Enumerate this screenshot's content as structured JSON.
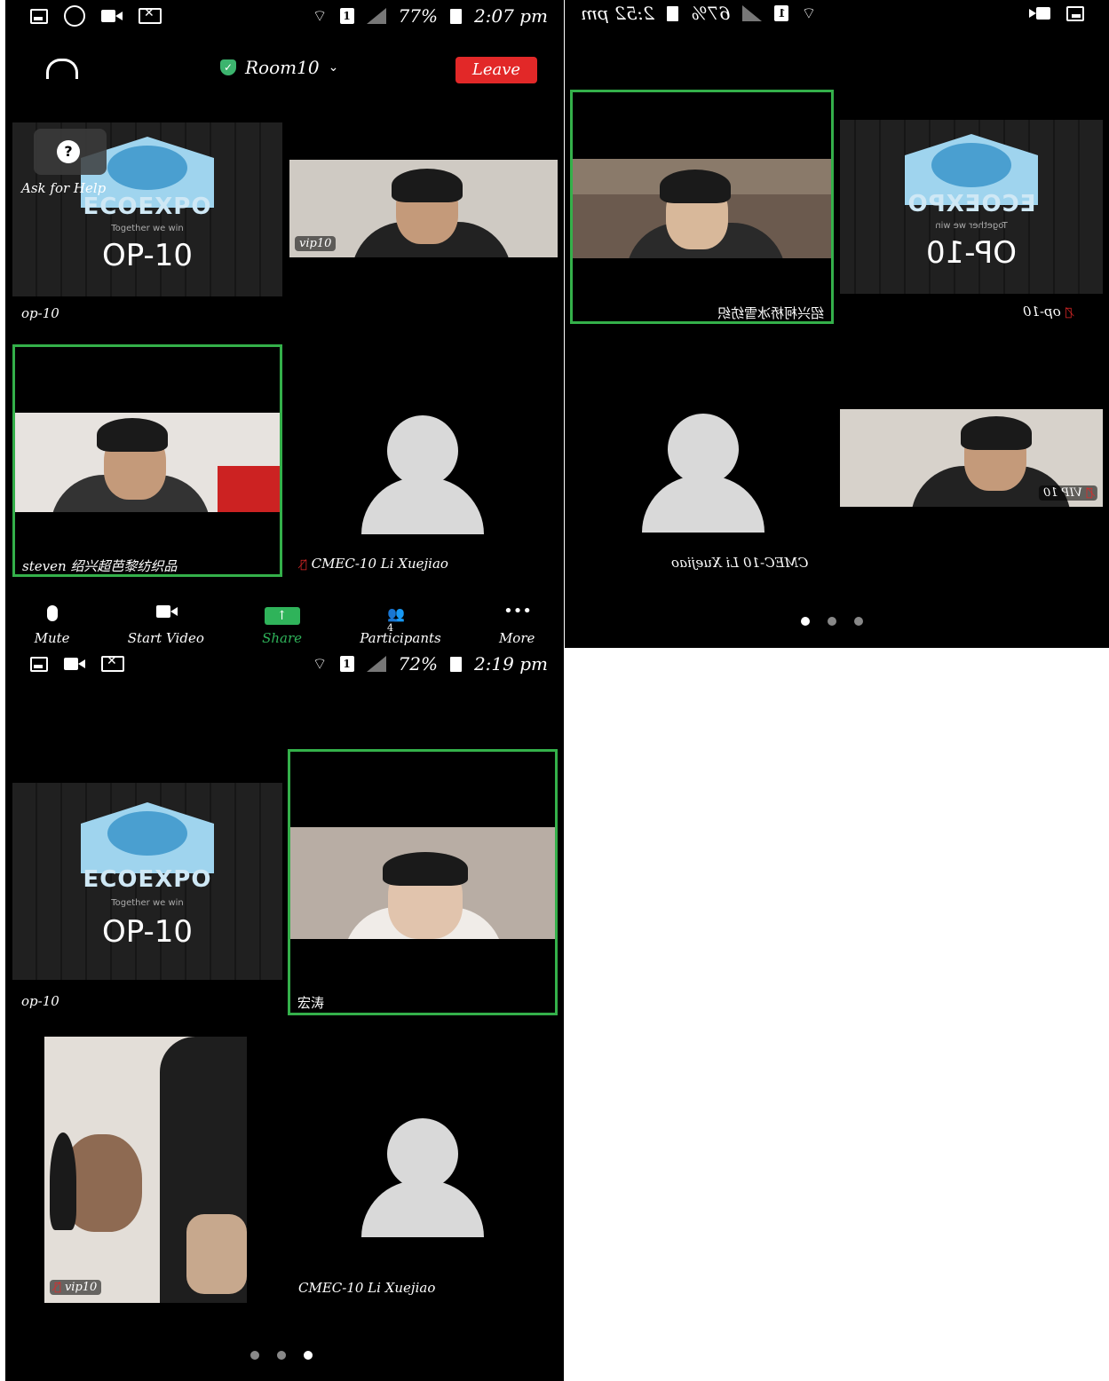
{
  "shot1": {
    "status": {
      "battery": "77%",
      "time": "2:07 pm"
    },
    "room": "Room10",
    "leave_label": "Leave",
    "help_label": "Ask for Help",
    "logo": {
      "eco": "ECOEXPO",
      "tag": "Together we win",
      "op": "OP-10"
    },
    "tiles": [
      {
        "name": "op-10"
      },
      {
        "name": "vip10"
      },
      {
        "name": "steven 绍兴超芭黎纺织品"
      },
      {
        "name": "CMEC-10 Li Xuejiao"
      }
    ],
    "participants_count": "4",
    "toolbar": {
      "mute": "Mute",
      "start_video": "Start Video",
      "share": "Share",
      "participants": "Participants",
      "more": "More"
    }
  },
  "shot2": {
    "status": {
      "battery": "67%",
      "time": "2:52 pm"
    },
    "logo": {
      "eco": "ECOEXPO",
      "tag": "Together we win",
      "op": "OP-10"
    },
    "tiles": [
      {
        "name": "绍兴柯桥冰雪纺织"
      },
      {
        "name": "op-10"
      },
      {
        "name": "CMEC-10 Li Xuejiao"
      },
      {
        "name": "VIP 10"
      }
    ]
  },
  "shot3": {
    "status": {
      "battery": "72%",
      "time": "2:19 pm"
    },
    "logo": {
      "eco": "ECOEXPO",
      "tag": "Together we win",
      "op": "OP-10"
    },
    "tiles": [
      {
        "name": "op-10"
      },
      {
        "name": "宏涛"
      },
      {
        "name": "vip10"
      },
      {
        "name": "CMEC-10 Li Xuejiao"
      }
    ]
  }
}
